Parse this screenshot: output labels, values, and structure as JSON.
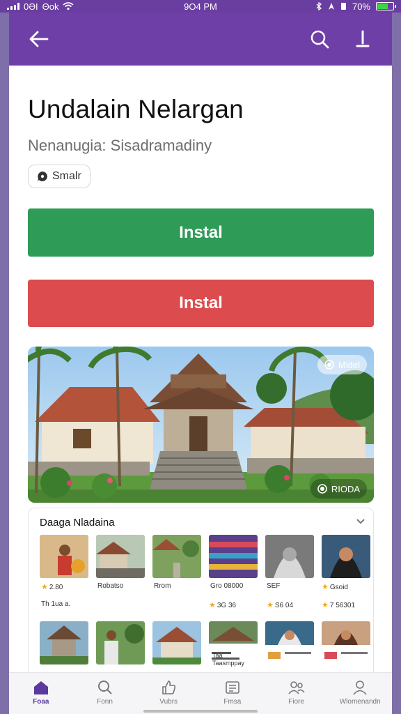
{
  "status_bar": {
    "carrier": "0ƏI",
    "network": "Θok",
    "time": "9O4 PM",
    "battery": "70%",
    "battery_level": 0.7
  },
  "app_bar": {
    "back_icon": "arrow-left-icon",
    "search_icon": "search-icon",
    "more_icon": "more-icon"
  },
  "app": {
    "title": "Undalain Nelargan",
    "subtitle": "Nenanugia: Sisadramadiny",
    "chip_label": "Smalr"
  },
  "buttons": {
    "primary_label": "Instal",
    "secondary_label": "Instal"
  },
  "hero": {
    "top_tag": "Midel",
    "bottom_tag": "RIODA"
  },
  "gallery": {
    "heading": "Daaga Nladaina",
    "row1": [
      {
        "caption": "2.80",
        "rating": true
      },
      {
        "caption": "Robatso",
        "rating": false
      },
      {
        "caption": "Rrom",
        "rating": false
      },
      {
        "caption": "Gro 08000",
        "rating": false
      },
      {
        "caption": "SEF",
        "rating": false
      },
      {
        "caption": "Gsoid",
        "rating": true
      }
    ],
    "row1b": [
      {
        "caption": "Th 1ua a.",
        "rating": false
      },
      {
        "caption": "3G 36",
        "rating": true
      },
      {
        "caption": "S6 04",
        "rating": true
      },
      {
        "caption": "7 56301",
        "rating": true
      }
    ],
    "row2_caption": "Taa Taasmppay"
  },
  "bottom_nav": [
    {
      "label": "Foaa",
      "icon": "home-icon",
      "active": true
    },
    {
      "label": "Fonn",
      "icon": "search-icon",
      "active": false
    },
    {
      "label": "Vubrs",
      "icon": "thumbs-up-icon",
      "active": false
    },
    {
      "label": "Fmsa",
      "icon": "list-icon",
      "active": false
    },
    {
      "label": "Fiore",
      "icon": "people-icon",
      "active": false
    },
    {
      "label": "Wlomenandn",
      "icon": "profile-icon",
      "active": false
    }
  ],
  "colors": {
    "app_bar": "#6f3fa8",
    "primary_button": "#2e9b57",
    "secondary_button": "#dc4b4e",
    "accent": "#5b3a9e"
  }
}
